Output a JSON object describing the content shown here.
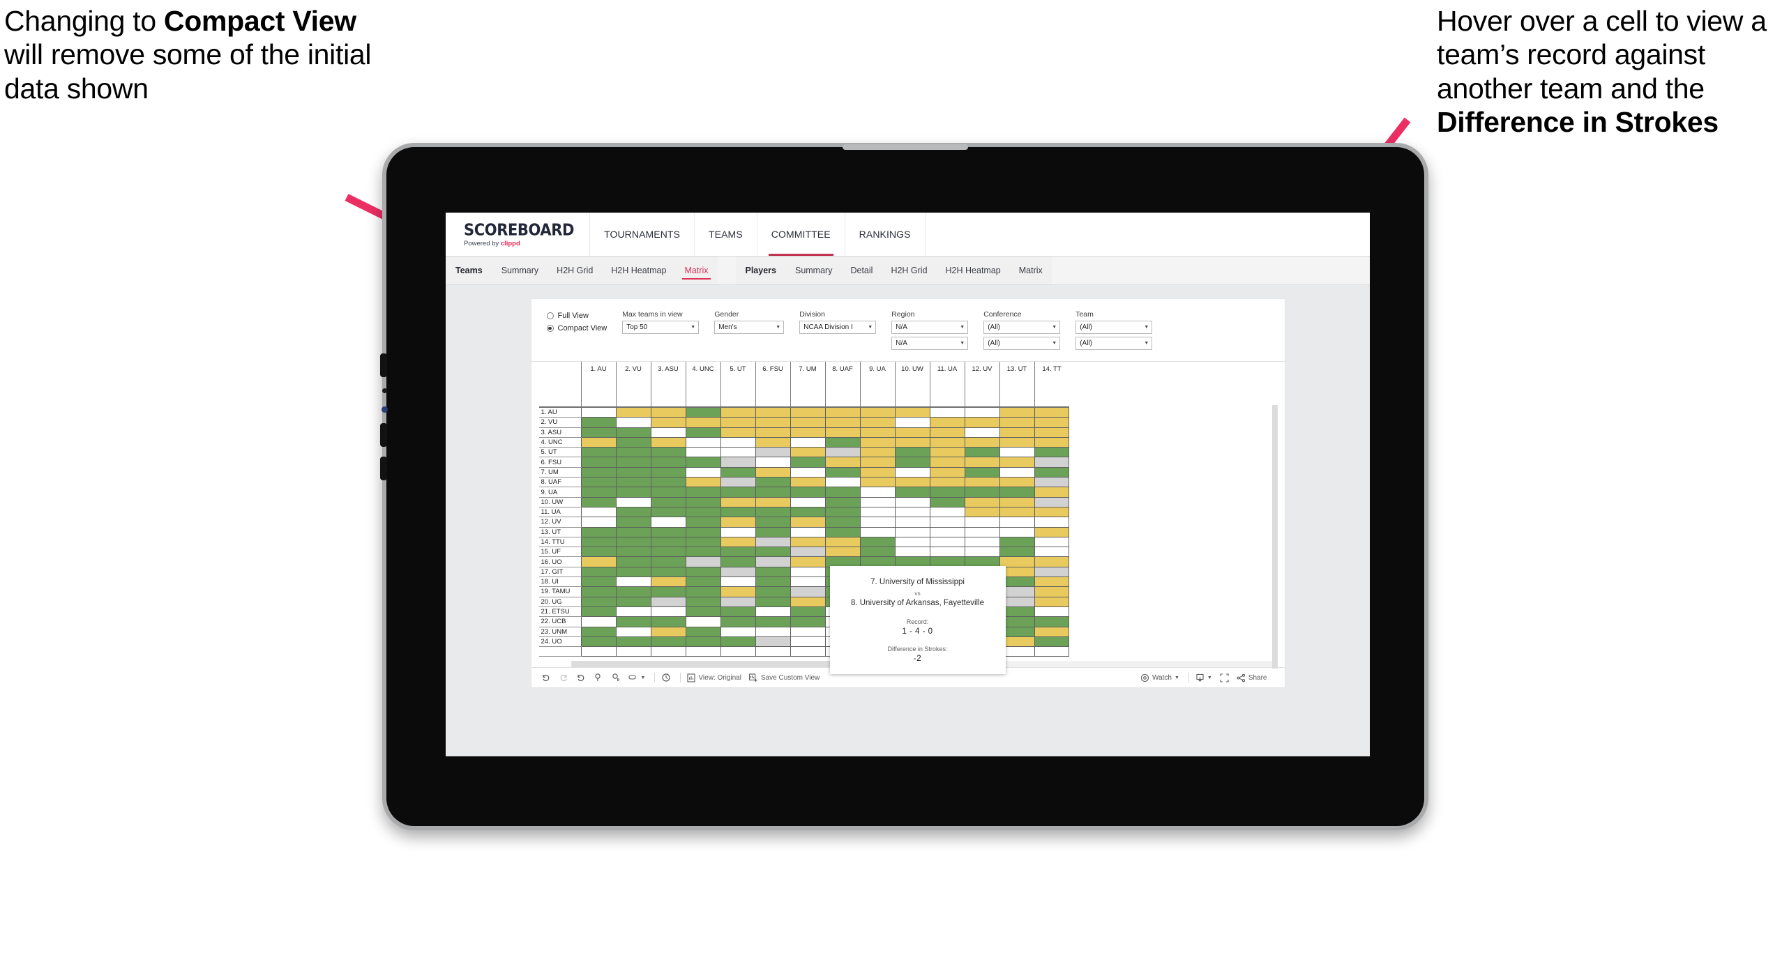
{
  "annotations": {
    "left": {
      "line1": "Changing to ",
      "bold": "Compact View",
      "line2": " will remove some of the initial data shown"
    },
    "right": {
      "line1": "Hover over a cell to view a team’s record against another team and the ",
      "bold": "Difference in Strokes",
      "line2": ""
    }
  },
  "app": {
    "brand": {
      "title": "SCOREBOARD",
      "powered_prefix": "Powered by ",
      "powered_brand": "clippd"
    },
    "topnav": [
      {
        "label": "TOURNAMENTS",
        "active": false
      },
      {
        "label": "TEAMS",
        "active": false
      },
      {
        "label": "COMMITTEE",
        "active": true
      },
      {
        "label": "RANKINGS",
        "active": false
      }
    ],
    "tabs_teams": {
      "group_label": "Teams",
      "items": [
        {
          "label": "Summary",
          "active": false
        },
        {
          "label": "H2H Grid",
          "active": false
        },
        {
          "label": "H2H Heatmap",
          "active": false
        },
        {
          "label": "Matrix",
          "active": true
        }
      ]
    },
    "tabs_players": {
      "group_label": "Players",
      "items": [
        {
          "label": "Summary",
          "active": false
        },
        {
          "label": "Detail",
          "active": false
        },
        {
          "label": "H2H Grid",
          "active": false
        },
        {
          "label": "H2H Heatmap",
          "active": false
        },
        {
          "label": "Matrix",
          "active": false
        }
      ]
    },
    "filters": {
      "view_mode": {
        "full": "Full View",
        "compact": "Compact View",
        "selected": "Compact View"
      },
      "max_teams": {
        "label": "Max teams in view",
        "value": "Top 50"
      },
      "gender": {
        "label": "Gender",
        "value": "Men's"
      },
      "division": {
        "label": "Division",
        "value": "NCAA Division I"
      },
      "region": {
        "label": "Region",
        "value1": "N/A",
        "value2": "N/A"
      },
      "conference": {
        "label": "Conference",
        "value1": "(All)",
        "value2": "(All)"
      },
      "team": {
        "label": "Team",
        "value1": "(All)",
        "value2": "(All)"
      }
    },
    "tooltip": {
      "team_a": "7. University of Mississippi",
      "vs": "vs",
      "team_b": "8. University of Arkansas, Fayetteville",
      "record_label": "Record:",
      "record_value": "1 - 4 - 0",
      "diff_label": "Difference in Strokes:",
      "diff_value": "-2"
    },
    "toolbar": {
      "undo": "undo-icon",
      "redo": "redo-icon",
      "revert": "revert-icon",
      "refresh": "refresh-icon",
      "pause": "pause-icon",
      "view_dropdown": "view-dropdown",
      "alerts": "alerts-icon",
      "view_original": "View: Original",
      "save_custom_view": "Save Custom View",
      "watch": "Watch",
      "download": "download-icon",
      "fullscreen": "fullscreen-icon",
      "share": "Share"
    }
  },
  "chart_data": {
    "type": "heatmap",
    "title": "Team Head-to-Head Matrix",
    "legend_colors": {
      "win": "#6ba257",
      "loss": "#e8ca5e",
      "tie": "#d2d2d2",
      "none": "#ffffff"
    },
    "columns": [
      "1. AU",
      "2. VU",
      "3. ASU",
      "4. UNC",
      "5. UT",
      "6. FSU",
      "7. UM",
      "8. UAF",
      "9. UA",
      "10. UW",
      "11. UA",
      "12. UV",
      "13. UT",
      "14. TT"
    ],
    "rows": [
      "1. AU",
      "2. VU",
      "3. ASU",
      "4. UNC",
      "5. UT",
      "6. FSU",
      "7. UM",
      "8. UAF",
      "9. UA",
      "10. UW",
      "11. UA",
      "12. UV",
      "13. UT",
      "14. TTU",
      "15. UF",
      "16. UO",
      "17. GIT",
      "18. UI",
      "19. TAMU",
      "20. UG",
      "21. ETSU",
      "22. UCB",
      "23. UNM",
      "24. UO"
    ],
    "cells": [
      [
        "w",
        "y",
        "y",
        "g",
        "y",
        "y",
        "y",
        "y",
        "y",
        "y",
        "w",
        "w",
        "y",
        "y"
      ],
      [
        "g",
        "w",
        "y",
        "y",
        "y",
        "y",
        "y",
        "y",
        "y",
        "w",
        "y",
        "y",
        "y",
        "y"
      ],
      [
        "g",
        "g",
        "w",
        "g",
        "y",
        "y",
        "y",
        "y",
        "y",
        "y",
        "y",
        "w",
        "y",
        "y"
      ],
      [
        "y",
        "g",
        "y",
        "w",
        "w",
        "y",
        "w",
        "g",
        "y",
        "y",
        "y",
        "y",
        "y",
        "y"
      ],
      [
        "g",
        "g",
        "g",
        "w",
        "w",
        "a",
        "y",
        "a",
        "y",
        "g",
        "y",
        "g",
        "w",
        "g"
      ],
      [
        "g",
        "g",
        "g",
        "g",
        "a",
        "w",
        "g",
        "y",
        "y",
        "g",
        "y",
        "y",
        "y",
        "a"
      ],
      [
        "g",
        "g",
        "g",
        "w",
        "g",
        "y",
        "w",
        "g",
        "y",
        "w",
        "y",
        "g",
        "w",
        "g"
      ],
      [
        "g",
        "g",
        "g",
        "y",
        "a",
        "g",
        "y",
        "w",
        "y",
        "y",
        "y",
        "y",
        "y",
        "a"
      ],
      [
        "g",
        "g",
        "g",
        "g",
        "g",
        "g",
        "g",
        "g",
        "w",
        "g",
        "g",
        "g",
        "g",
        "y"
      ],
      [
        "g",
        "w",
        "g",
        "g",
        "y",
        "y",
        "w",
        "g",
        "w",
        "w",
        "g",
        "y",
        "y",
        "a"
      ],
      [
        "w",
        "g",
        "g",
        "g",
        "g",
        "g",
        "g",
        "g",
        "w",
        "w",
        "w",
        "y",
        "y",
        "y"
      ],
      [
        "w",
        "g",
        "w",
        "g",
        "y",
        "g",
        "y",
        "g",
        "w",
        "w",
        "w",
        "w",
        "w",
        "w"
      ],
      [
        "g",
        "g",
        "g",
        "g",
        "w",
        "g",
        "w",
        "g",
        "w",
        "w",
        "w",
        "w",
        "w",
        "y"
      ],
      [
        "g",
        "g",
        "g",
        "g",
        "y",
        "a",
        "y",
        "y",
        "g",
        "w",
        "w",
        "w",
        "g",
        "w"
      ],
      [
        "g",
        "g",
        "g",
        "g",
        "g",
        "g",
        "a",
        "y",
        "g",
        "w",
        "w",
        "w",
        "g",
        "w"
      ],
      [
        "y",
        "g",
        "g",
        "a",
        "g",
        "a",
        "y",
        "g",
        "g",
        "g",
        "g",
        "g",
        "y",
        "y"
      ],
      [
        "g",
        "g",
        "g",
        "g",
        "a",
        "g",
        "w",
        "g",
        "g",
        "g",
        "g",
        "a",
        "y",
        "a"
      ],
      [
        "g",
        "w",
        "y",
        "g",
        "w",
        "g",
        "w",
        "g",
        "g",
        "g",
        "g",
        "w",
        "g",
        "y"
      ],
      [
        "g",
        "g",
        "g",
        "g",
        "y",
        "g",
        "a",
        "g",
        "y",
        "g",
        "g",
        "g",
        "a",
        "y"
      ],
      [
        "g",
        "g",
        "a",
        "g",
        "a",
        "g",
        "y",
        "g",
        "g",
        "w",
        "w",
        "g",
        "a",
        "y"
      ],
      [
        "g",
        "w",
        "w",
        "g",
        "g",
        "w",
        "g",
        "w",
        "w",
        "y",
        "w",
        "g",
        "g",
        "w"
      ],
      [
        "w",
        "g",
        "g",
        "w",
        "g",
        "g",
        "g",
        "w",
        "g",
        "y",
        "w",
        "y",
        "g",
        "g"
      ],
      [
        "g",
        "w",
        "y",
        "g",
        "w",
        "w",
        "w",
        "w",
        "w",
        "y",
        "g",
        "w",
        "g",
        "y"
      ],
      [
        "g",
        "g",
        "g",
        "g",
        "g",
        "a",
        "w",
        "w",
        "w",
        "g",
        "y",
        "w",
        "y",
        "g"
      ]
    ]
  }
}
